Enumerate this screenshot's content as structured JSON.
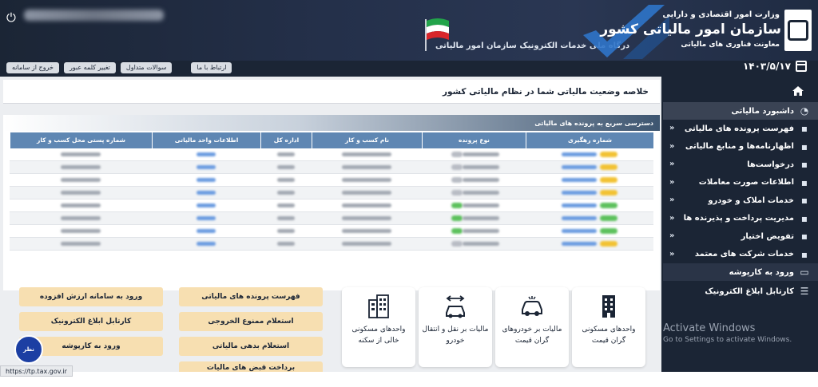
{
  "header": {
    "brand_small": "وزارت امور اقتصادی و دارایی",
    "brand_big": "سازمان امور مالیاتی کشور",
    "brand_sub": "معاونت فناوری های مالیاتی",
    "portal_title": "درگاه ملی خدمات الکترونیک سازمان امور مالیاتی",
    "date": "۱۴۰۳/۵/۱۷"
  },
  "top_buttons": {
    "exit": "خروج از سامانه",
    "change_password": "تغییر کلمه عبور",
    "faq": "سوالات متداول",
    "contact": "ارتباط با ما"
  },
  "sidebar": {
    "dashboard": "داشبورد مالیاتی",
    "items": [
      {
        "label": "فهرست پرونده های مالیاتی",
        "icon": "folder-list-icon",
        "chev": "»"
      },
      {
        "label": "اظهارنامه‌ها و منابع مالیاتی",
        "icon": "declaration-icon",
        "chev": "»"
      },
      {
        "label": "درخواست‌ها",
        "icon": "requests-icon",
        "chev": "»"
      },
      {
        "label": "اطلاعات صورت معاملات",
        "icon": "transactions-icon",
        "chev": "»"
      },
      {
        "label": "خدمات املاک و خودرو",
        "icon": "car-icon",
        "chev": "»"
      },
      {
        "label": "مدیریت پرداخت و پذیرنده ها",
        "icon": "payment-icon",
        "chev": "»"
      },
      {
        "label": "تفویض اختیار",
        "icon": "delegation-icon",
        "chev": "»"
      },
      {
        "label": "خدمات شرکت های معتمد",
        "icon": "trusted-company-icon",
        "chev": "»"
      }
    ],
    "login_taxpayer": "ورود به کارپوشه",
    "e_notice": "کارتابل ابلاغ الکترونیک"
  },
  "watermark": {
    "line1": "Activate Windows",
    "line2": "Go to Settings to activate Windows."
  },
  "main": {
    "title": "خلاصه وضعیت مالیاتی شما در نظام مالیاتی کشور",
    "quick_access": "دسترسی سریع به پرونده های مالیاتی",
    "columns": [
      "شماره رهگیری",
      "نوع پرونده",
      "نام کسب و کار",
      "اداره کل",
      "اطلاعات واحد مالیاتی",
      "شماره پستی محل کسب و کار"
    ]
  },
  "table_rows": [
    {
      "badge": "#f2c233"
    },
    {
      "badge": "#f2c233"
    },
    {
      "badge": "#f2c233"
    },
    {
      "badge": "#f2c233"
    },
    {
      "badge": "#5cc15c"
    },
    {
      "badge": "#5cc15c"
    },
    {
      "badge": "#5cc15c"
    },
    {
      "badge": "#f2c233"
    }
  ],
  "cards": [
    {
      "label": "واحدهای مسکونی گران قیمت"
    },
    {
      "label": "مالیات بر خودروهای گران قیمت"
    },
    {
      "label": "مالیات بر نقل و انتقال خودرو"
    },
    {
      "label": "واحدهای مسکونی خالی از سکنه"
    }
  ],
  "link_buttons": {
    "file_list": "فهرست پرونده های مالیاتی",
    "exit_ban": "استعلام ممنوع الخروجی",
    "tax_debt": "استعلام بدهی مالیاتی",
    "tax_receipt": "برداخت قبض های مالیات",
    "vat_login": "ورود به سامانه ارزش افزوده",
    "e_notice": "کارتابل ابلاغ الکترونیک",
    "folder_login": "ورود به کارپوشه"
  },
  "feedback": "نظر سنجی",
  "status_url": "https://tp.tax.gov.ir",
  "colors": {
    "accent": "#5f87b3",
    "sidebar": "#1b2535",
    "button": "#f7dfb1"
  }
}
